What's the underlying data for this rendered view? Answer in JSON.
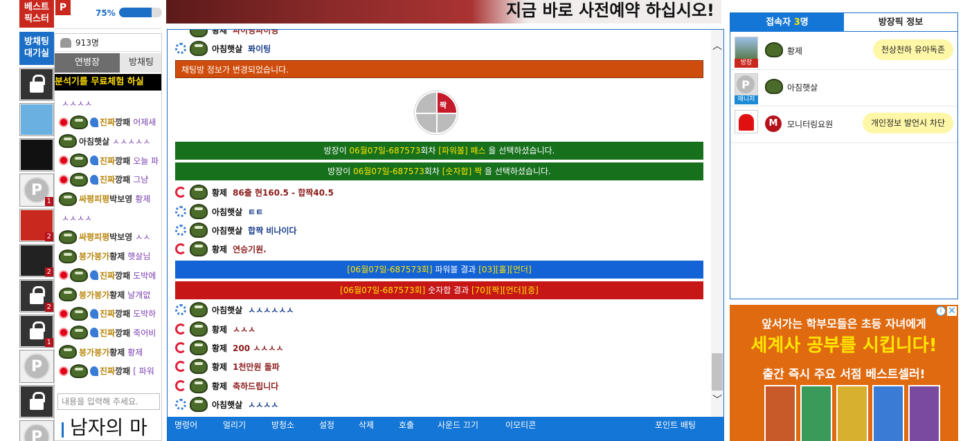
{
  "colors": {
    "accent": "#1476d6",
    "system_orange": "#cf4d0c",
    "system_green": "#16701c",
    "system_blue": "#1363d6",
    "system_red": "#c61616",
    "highlight": "#ffe600"
  },
  "sidebar": {
    "tag1": "베스트\n픽스터",
    "tag2": "방채팅\n대기실",
    "boxes": [
      {
        "icon": "lock-icon",
        "badge": ""
      },
      {
        "icon": "psyduck-avatar-icon",
        "badge": ""
      },
      {
        "icon": "dragon-avatar-icon",
        "badge": ""
      },
      {
        "icon": "p-avatar-icon",
        "badge": "1"
      },
      {
        "icon": "kkangpae-avatar-icon",
        "badge": "2"
      },
      {
        "icon": "kkuma-avatar-icon",
        "badge": "2"
      },
      {
        "icon": "lock-icon",
        "badge": "2"
      },
      {
        "icon": "lock-icon",
        "badge": "1"
      },
      {
        "icon": "p-avatar-icon",
        "badge": ""
      },
      {
        "icon": "lock-icon",
        "badge": ""
      },
      {
        "icon": "p-avatar-icon",
        "badge": ""
      }
    ]
  },
  "topstrip": {
    "logo": "P",
    "percent_label": "75%",
    "progress": 0.75
  },
  "leftchat": {
    "online_count": "913명",
    "tab1": "연병장",
    "tab2": "방채팅",
    "marquee": "분석기를 무료체험 하실",
    "messages": [
      {
        "clan": "",
        "nick": "",
        "msg": "ㅅㅅㅅㅅ"
      },
      {
        "clan": "진짜",
        "nick": "깡패",
        "msg": "어제새"
      },
      {
        "clan": "",
        "nick": "아침햇살",
        "msg": "ㅅㅅㅅㅅㅅ"
      },
      {
        "clan": "진짜",
        "nick": "깡패",
        "msg": "오늘 파"
      },
      {
        "clan": "진짜",
        "nick": "깡패",
        "msg": "그냥"
      },
      {
        "clan": "싸평피평",
        "nick": "박보영",
        "msg": "황제"
      },
      {
        "clan": "",
        "nick": "",
        "msg": "ㅅㅅㅅㅅ"
      },
      {
        "clan": "싸평피평",
        "nick": "박보영",
        "msg": "ㅅㅅ"
      },
      {
        "clan": "붕가붕가",
        "nick": "황제",
        "msg": "햇살님"
      },
      {
        "clan": "진짜",
        "nick": "깡패",
        "msg": "도박에"
      },
      {
        "clan": "붕가붕가",
        "nick": "황제",
        "msg": "날개없"
      },
      {
        "clan": "진짜",
        "nick": "깡패",
        "msg": "도박하"
      },
      {
        "clan": "진짜",
        "nick": "깡패",
        "msg": "죽어비"
      },
      {
        "clan": "붕가붕가",
        "nick": "황제",
        "msg": "황제"
      },
      {
        "clan": "진짜",
        "nick": "깡패",
        "msg": "[ 파워"
      }
    ],
    "input_placeholder": "내용을 입력해 주세요.",
    "bottom_title": "남자의 마"
  },
  "banner": {
    "text": "지금 바로 사전예약 하십시오!"
  },
  "main": {
    "partial_top": {
      "nick": "황제",
      "msg": "파이팅파이팅"
    },
    "rows": [
      {
        "kind": "user",
        "icon": "flower",
        "nick": "아침햇살",
        "msg": "퐈이팅",
        "color": "blue"
      },
      {
        "kind": "sys",
        "style": "orange",
        "text": "채팅방 정보가 변경되었습니다."
      },
      {
        "kind": "pie",
        "label": "짝"
      },
      {
        "kind": "sys",
        "style": "green",
        "pre": "방장이 ",
        "hl1": "06월07일-687573",
        "mid": "회차 ",
        "hl2": "[파워볼] 패스",
        "post": " 을 선택하셨습니다."
      },
      {
        "kind": "sys",
        "style": "green",
        "pre": "방장이 ",
        "hl1": "06월07일-687573",
        "mid": "회차 ",
        "hl2": "[숫자합] 짝",
        "post": " 을 선택하셨습니다."
      },
      {
        "kind": "user",
        "icon": "swirl",
        "nick": "황제",
        "msg": "86출 현160.5 - 합짝40.5",
        "color": "red"
      },
      {
        "kind": "user",
        "icon": "flower",
        "nick": "아침햇살",
        "msg": "ㅌㅌ",
        "color": "blue"
      },
      {
        "kind": "user",
        "icon": "flower",
        "nick": "아침햇살",
        "msg": "합짝 비나이다",
        "color": "blue"
      },
      {
        "kind": "user",
        "icon": "swirl",
        "nick": "황제",
        "msg": "연승기원.",
        "color": "red"
      },
      {
        "kind": "sys",
        "style": "blue",
        "pre": "",
        "hl1": "[06월07일-687573회]",
        "mid": " 파워볼 결과 ",
        "hl2": "[03][홀][언더]",
        "post": ""
      },
      {
        "kind": "sys",
        "style": "red",
        "pre": "",
        "hl1": "[06월07일-687573회]",
        "mid": " 숫자합 결과 ",
        "hl2": "[70][짝][언더][중]",
        "post": ""
      },
      {
        "kind": "user",
        "icon": "flower",
        "nick": "아침햇살",
        "msg": "ㅅㅅㅅㅅㅅㅅ",
        "color": "blue"
      },
      {
        "kind": "user",
        "icon": "swirl",
        "nick": "황제",
        "msg": "ㅅㅅㅅ",
        "color": "red"
      },
      {
        "kind": "user",
        "icon": "swirl",
        "nick": "황제",
        "msg": "200 ㅅㅅㅅㅅ",
        "color": "red"
      },
      {
        "kind": "user",
        "icon": "swirl",
        "nick": "황제",
        "msg": "1천만원 돌파",
        "color": "red"
      },
      {
        "kind": "user",
        "icon": "swirl",
        "nick": "황제",
        "msg": "축하드립니다",
        "color": "red"
      },
      {
        "kind": "user",
        "icon": "flower",
        "nick": "아침햇살",
        "msg": "ㅅㅅㅅㅅ",
        "color": "blue"
      }
    ],
    "toolbar": [
      "명령어",
      "얼리기",
      "방청소",
      "설정",
      "삭제",
      "호출",
      "사운드 끄기",
      "이모티콘",
      "포인트 배팅"
    ]
  },
  "rightpanel": {
    "tab1_prefix": "접속자 ",
    "tab1_count": "3",
    "tab1_suffix": "명",
    "tab2": "방장픽 정보",
    "users": [
      {
        "role": "방장",
        "name": "황제",
        "bubble": "천상천하 유아독존"
      },
      {
        "role": "매니저",
        "name": "아침햇살",
        "bubble": ""
      },
      {
        "role": "",
        "name": "모니터링요원",
        "bubble": "개인정보 발언시 차단"
      }
    ]
  },
  "ad": {
    "info": "i",
    "close": "✕",
    "line1": "앞서가는 학부모들은 초등 자녀에게",
    "line2": "세계사 공부를 시킵니다!",
    "line3": "출간 즉시 주요 서점 베스트셀러!"
  }
}
